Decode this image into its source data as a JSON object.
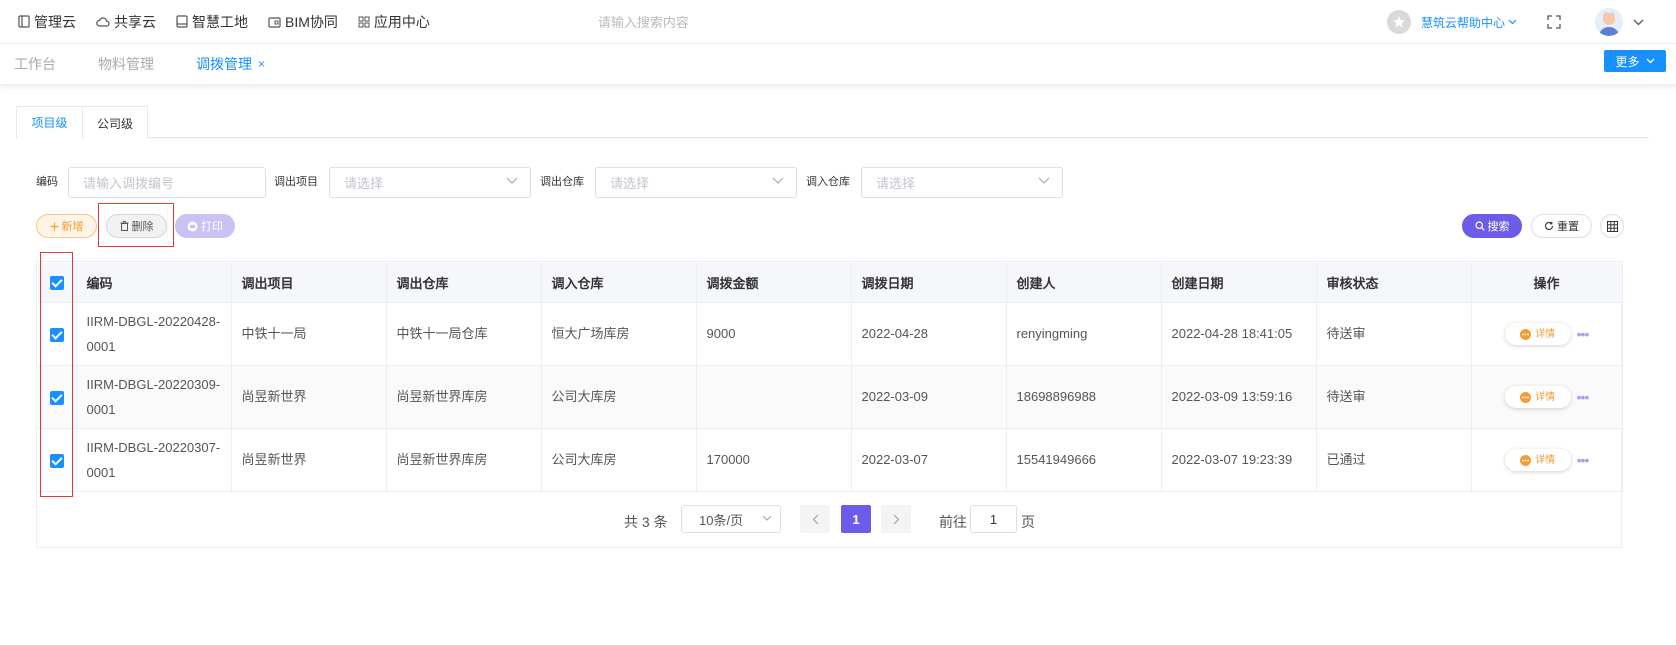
{
  "topnav": {
    "items": [
      {
        "label": "管理云",
        "icon": "book-icon"
      },
      {
        "label": "共享云",
        "icon": "cloud-icon"
      },
      {
        "label": "智慧工地",
        "icon": "book-icon"
      },
      {
        "label": "BIM协同",
        "icon": "folder-icon"
      },
      {
        "label": "应用中心",
        "icon": "grid-icon"
      }
    ],
    "search_placeholder": "请输入搜索内容",
    "help_center": "慧筑云帮助中心"
  },
  "tabsbar": {
    "tabs": [
      "工作台",
      "物料管理",
      "调拨管理"
    ],
    "close": "×",
    "more": "更多"
  },
  "level_tabs": [
    "项目级",
    "公司级"
  ],
  "filters": {
    "code_label": "编码",
    "code_placeholder": "请输入调拨编号",
    "out_project_label": "调出项目",
    "out_project_placeholder": "请选择",
    "out_warehouse_label": "调出仓库",
    "out_warehouse_placeholder": "请选择",
    "in_warehouse_label": "调入仓库",
    "in_warehouse_placeholder": "请选择"
  },
  "actions": {
    "add": "新增",
    "delete": "删除",
    "print": "打印",
    "search": "搜索",
    "reset": "重置"
  },
  "table": {
    "headers": [
      "编码",
      "调出项目",
      "调出仓库",
      "调入仓库",
      "调拨金额",
      "调拨日期",
      "创建人",
      "创建日期",
      "审核状态",
      "操作"
    ],
    "rows": [
      {
        "code": "IIRM-DBGL-20220428-0001",
        "out_project": "中铁十一局",
        "out_warehouse": "中铁十一局仓库",
        "in_warehouse": "恒大广场库房",
        "amount": "9000",
        "date": "2022-04-28",
        "creator": "renyingming",
        "created": "2022-04-28 18:41:05",
        "status": "待送审"
      },
      {
        "code": "IIRM-DBGL-20220309-0001",
        "out_project": "尚昱新世界",
        "out_warehouse": "尚昱新世界库房",
        "in_warehouse": "公司大库房",
        "amount": "",
        "date": "2022-03-09",
        "creator": "18698896988",
        "created": "2022-03-09 13:59:16",
        "status": "待送审"
      },
      {
        "code": "IIRM-DBGL-20220307-0001",
        "out_project": "尚昱新世界",
        "out_warehouse": "尚昱新世界库房",
        "in_warehouse": "公司大库房",
        "amount": "170000",
        "date": "2022-03-07",
        "creator": "15541949666",
        "created": "2022-03-07 19:23:39",
        "status": "已通过"
      }
    ],
    "detail_label": "详情"
  },
  "pagination": {
    "total": "共 3 条",
    "page_size": "10条/页",
    "current": "1",
    "goto_label": "前往",
    "goto_value": "1",
    "page_suffix": "页"
  },
  "colors": {
    "primary": "#1890ff",
    "purple": "#6c5ce7",
    "orange": "#f39c35",
    "highlight_box": "#e53935"
  }
}
